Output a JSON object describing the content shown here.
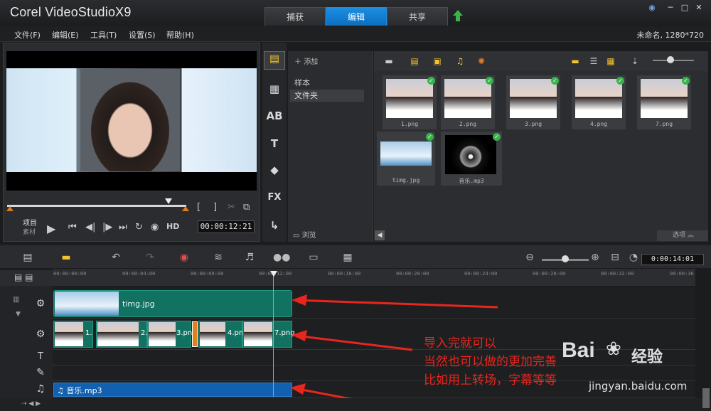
{
  "app": {
    "logo": "Corel VideoStudioX9",
    "project": "未命名, 1280*720"
  },
  "tabs": [
    {
      "label": "捕获"
    },
    {
      "label": "编辑"
    },
    {
      "label": "共享"
    }
  ],
  "menu": [
    "文件(F)",
    "编辑(E)",
    "工具(T)",
    "设置(S)",
    "帮助(H)"
  ],
  "player": {
    "project_label": "项目",
    "clip_label": "素材",
    "timecode": "00:00:12:21",
    "hd": "HD",
    "mark_in": "[",
    "mark_out": "]"
  },
  "library": {
    "add": "添加",
    "nav": [
      "样本",
      "文件夹"
    ],
    "browse": "浏览",
    "options": "选项",
    "thumbs": [
      {
        "name": "1.png"
      },
      {
        "name": "2.png"
      },
      {
        "name": "3.png"
      },
      {
        "name": "4.png"
      },
      {
        "name": "7.png"
      },
      {
        "name": "timg.jpg"
      },
      {
        "name": "音乐.mp3"
      }
    ]
  },
  "timeline": {
    "time": "0:00:14:01",
    "ticks": [
      "00:00:00:00",
      "00:00:04:00",
      "00:00:08:00",
      "00:00:12:00",
      "00:00:16:00",
      "00:00:20:00",
      "00:00:24:00",
      "00:00:28:00",
      "00:00:32:00",
      "00:00:36"
    ],
    "overlay_clip": "timg.jpg",
    "audio_clip": "音乐.mp3",
    "video_clips": [
      "1.",
      "2.",
      "3.pn",
      "4.png",
      "7.png"
    ]
  },
  "annotations": [
    "导入完就可以",
    "当然也可以做的更加完善",
    "比如用上转场，字幕等等"
  ],
  "watermark": {
    "brand": "Bai",
    "brand2": "经验",
    "url": "jingyan.baidu.com"
  }
}
